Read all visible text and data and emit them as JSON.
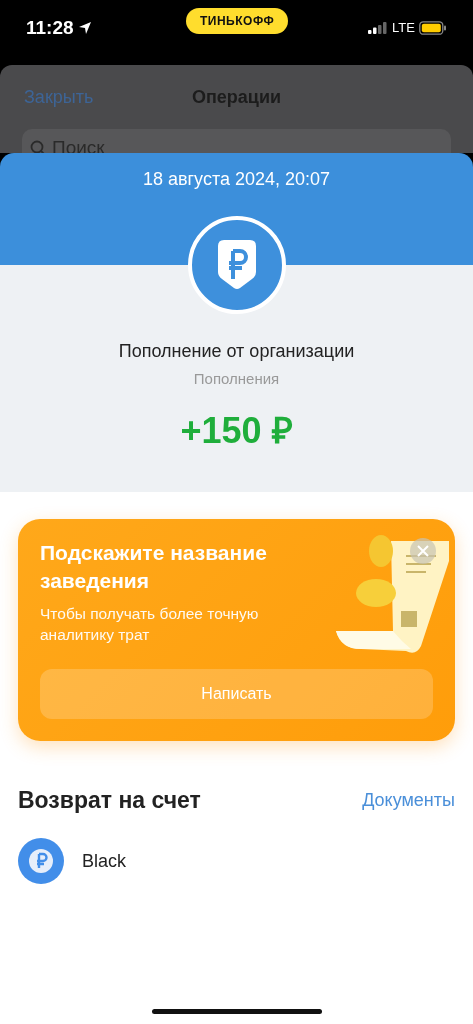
{
  "status_bar": {
    "time": "11:28",
    "brand": "ТИНЬКОФФ",
    "network": "LTE"
  },
  "background_sheet": {
    "close": "Закрыть",
    "title": "Операции",
    "search": {
      "placeholder": "Поиск"
    }
  },
  "operation": {
    "date": "18 августа 2024, 20:07",
    "title": "Пополнение от организации",
    "category": "Пополнения",
    "amount": "+150 ₽"
  },
  "promo": {
    "title": "Подскажите название заведения",
    "text": "Чтобы получать более точную аналитику трат",
    "button": "Написать"
  },
  "section": {
    "title": "Возврат на счет",
    "link": "Документы"
  },
  "accounts": [
    {
      "name": "Black"
    }
  ]
}
